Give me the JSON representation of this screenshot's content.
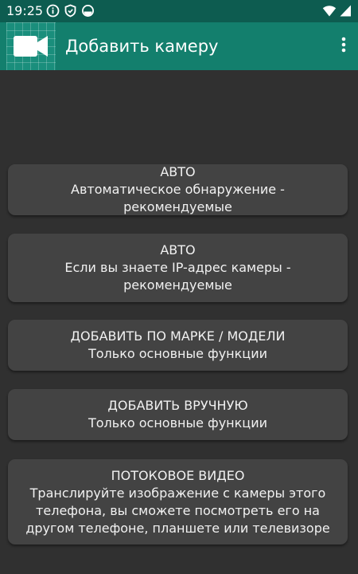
{
  "status_bar": {
    "time": "19:25",
    "icons_left": [
      "info-icon",
      "shield-icon",
      "data-saver-icon"
    ],
    "icons_right": [
      "wifi-icon",
      "signal-icon"
    ]
  },
  "app_bar": {
    "title": "Добавить камеру",
    "logo_icon": "video-camera-icon",
    "menu_icon": "more-vertical-icon"
  },
  "colors": {
    "status_bar": "#0d5c50",
    "app_bar": "#137f6d",
    "background": "#303030",
    "card": "#434343",
    "text": "#f1f1f1"
  },
  "options": [
    {
      "title": "АВТО",
      "description": "Автоматическое обнаружение - рекомендуемые"
    },
    {
      "title": "АВТО",
      "description": "Если вы знаете IP-адрес камеры - рекомендуемые"
    },
    {
      "title": "ДОБАВИТЬ ПО МАРКЕ / МОДЕЛИ",
      "description": "Только основные функции"
    },
    {
      "title": "ДОБАВИТЬ ВРУЧНУЮ",
      "description": "Только основные функции"
    },
    {
      "title": "ПОТОКОВОЕ ВИДЕО",
      "description": "Транслируйте изображение с камеры этого телефона, вы сможете посмотреть его на другом телефоне, планшете или телевизоре"
    }
  ]
}
